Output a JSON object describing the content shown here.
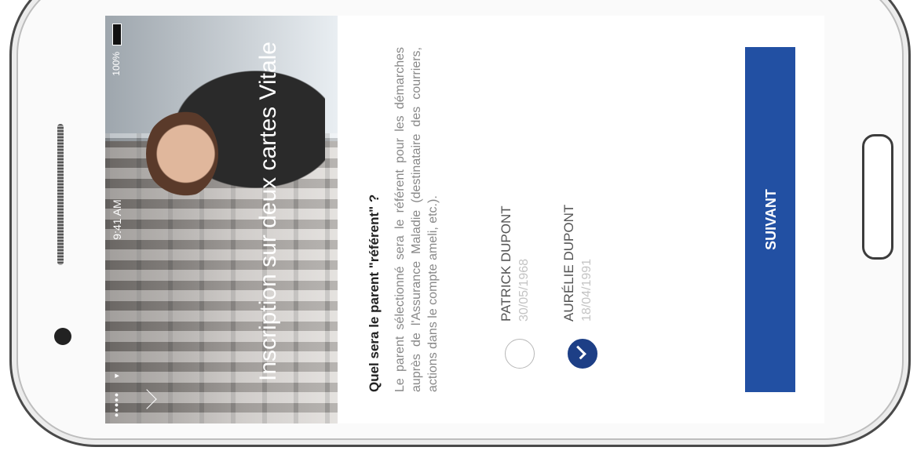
{
  "status_bar": {
    "signal": "●●●●●",
    "wifi_icon": "wifi-icon",
    "time": "9:41 AM",
    "battery": "100%"
  },
  "hero": {
    "title": "Inscription sur deux cartes Vitale"
  },
  "form": {
    "question": "Quel sera le parent \"référent\" ?",
    "description": "Le parent sélectionné sera le référent pour les démarches auprès de l'Assurance Maladie (destinataire des courriers, actions dans le compte ameli, etc.).",
    "options": [
      {
        "name": "PATRICK DUPONT",
        "date": "30/05/1968",
        "selected": false
      },
      {
        "name": "AURÉLIE DUPONT",
        "date": "18/04/1991",
        "selected": true
      }
    ],
    "next_label": "SUIVANT"
  },
  "colors": {
    "accent": "#2250a3",
    "check": "#1d3f86"
  }
}
